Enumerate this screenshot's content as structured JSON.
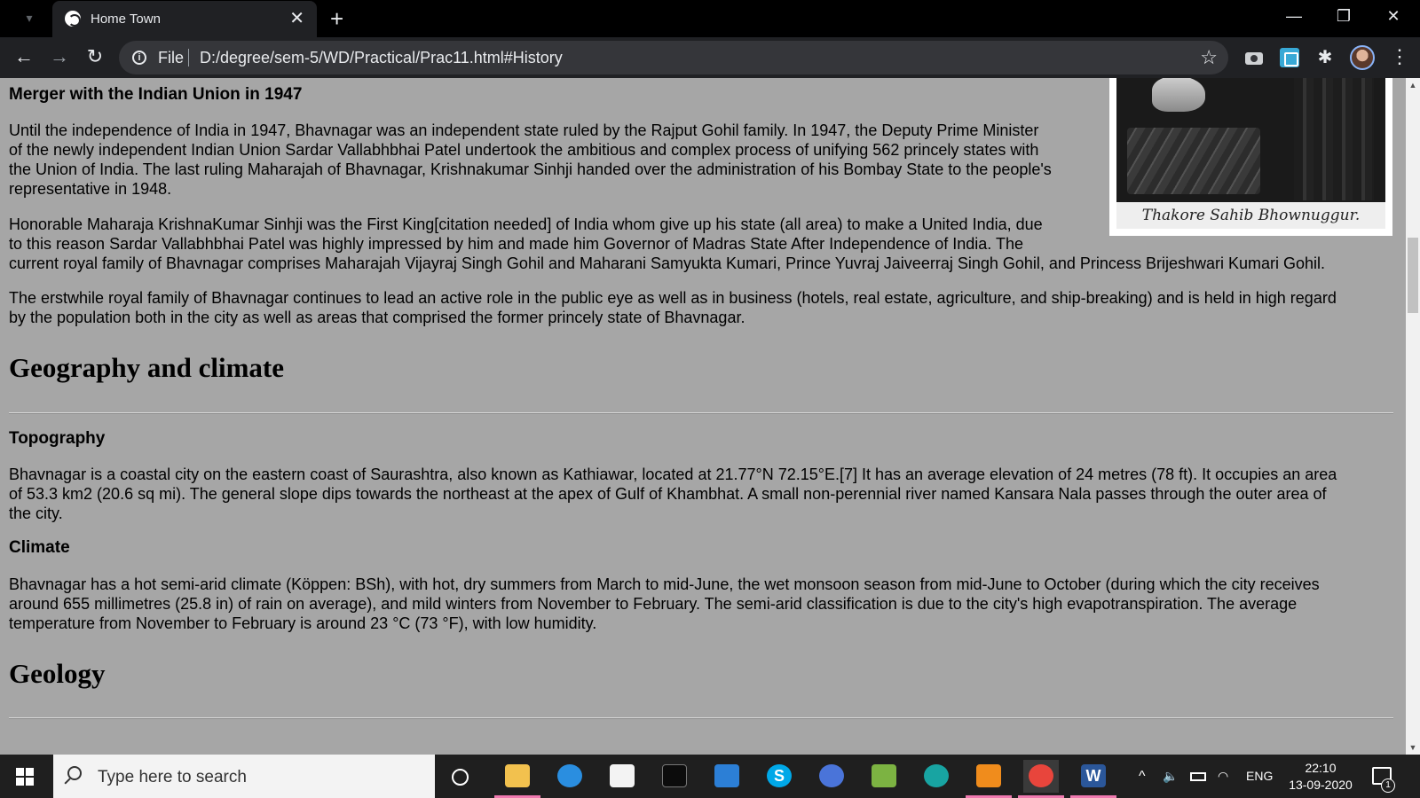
{
  "browser": {
    "tab_title": "Home Town",
    "tab_close_glyph": "✕",
    "new_tab_glyph": "+",
    "minimize_glyph": "—",
    "maximize_glyph": "❐",
    "close_glyph": "✕",
    "back_glyph": "←",
    "forward_glyph": "→",
    "reload_glyph": "↻",
    "info_glyph": "i",
    "scheme_label": "File",
    "url": "D:/degree/sem-5/WD/Practical/Prac11.html#History",
    "star_glyph": "☆",
    "puzzle_glyph": "✱",
    "menu_glyph": "⋮"
  },
  "page": {
    "image_caption": "Thakore Sahib Bhownuggur.",
    "merger": {
      "heading": "Merger with the Indian Union in 1947",
      "p1_l1": "Until the independence of India in 1947, Bhavnagar was an independent state ruled by the Rajput Gohil family. In 1947, the Deputy Prime Minister",
      "p1_l2": "of the newly independent Indian Union Sardar Vallabhbhai Patel undertook the ambitious and complex process of unifying 562 princely states with",
      "p1_l3": "the Union of India. The last ruling Maharajah of Bhavnagar, Krishnakumar Sinhji handed over the administration of his Bombay State to the people's",
      "p1_l4": "representative in 1948.",
      "p2_l1": "Honorable Maharaja KrishnaKumar Sinhji was the First King[citation needed] of India whom give up his state (all area) to make a United India, due",
      "p2_l2": "to this reason Sardar Vallabhbhai Patel was highly impressed by him and made him Governor of Madras State After Independence of India. The",
      "p2_l3": "current royal family of Bhavnagar comprises Maharajah Vijayraj Singh Gohil and Maharani Samyukta Kumari, Prince Yuvraj Jaiveerraj Singh Gohil, and Princess Brijeshwari Kumari Gohil.",
      "p3_l1": "The erstwhile royal family of Bhavnagar continues to lead an active role in the public eye as well as in business (hotels, real estate, agriculture, and ship-breaking) and is held in high regard",
      "p3_l2": "by the population both in the city as well as areas that comprised the former princely state of Bhavnagar."
    },
    "geography": {
      "heading": "Geography and climate",
      "topography_heading": "Topography",
      "topo_l1": "Bhavnagar is a coastal city on the eastern coast of Saurashtra, also known as Kathiawar, located at 21.77°N 72.15°E.[7] It has an average elevation of 24 metres (78 ft). It occupies an area",
      "topo_l2": "of 53.3 km2 (20.6 sq mi). The general slope dips towards the northeast at the apex of Gulf of Khambhat. A small non-perennial river named Kansara Nala passes through the outer area of",
      "topo_l3": "the city.",
      "climate_heading": "Climate",
      "clim_l1": "Bhavnagar has a hot semi-arid climate (Köppen: BSh), with hot, dry summers from March to mid-June, the wet monsoon season from mid-June to October (during which the city receives",
      "clim_l2": "around 655 millimetres (25.8 in) of rain on average), and mild winters from November to February. The semi-arid classification is due to the city's high evapotranspiration. The average",
      "clim_l3": "temperature from November to February is around 23 °C (73 °F), with low humidity."
    },
    "geology_heading": "Geology"
  },
  "taskbar": {
    "search_placeholder": "Type here to search",
    "apps": [
      {
        "name": "file-explorer",
        "color": "#f2c14e"
      },
      {
        "name": "internet-explorer",
        "color": "#2a8ee0"
      },
      {
        "name": "store",
        "color": "#f3f3f3"
      },
      {
        "name": "terminal",
        "color": "#0c0c0c"
      },
      {
        "name": "mail",
        "color": "#2c7fd6"
      },
      {
        "name": "skype",
        "color": "#00a8e8"
      },
      {
        "name": "chromium",
        "color": "#4a74d9"
      },
      {
        "name": "notepad-plus",
        "color": "#7cb342"
      },
      {
        "name": "edge",
        "color": "#18a4a2"
      },
      {
        "name": "sublime-text",
        "color": "#f08c1c"
      },
      {
        "name": "chrome",
        "color": "#e8453c"
      },
      {
        "name": "word",
        "color": "#2b579a"
      }
    ],
    "skype_letter": "S",
    "word_letter": "W",
    "tray_chevron": "^",
    "volume_glyph": "🔈",
    "language": "ENG",
    "time": "22:10",
    "date": "13-09-2020",
    "notification_count": "1"
  }
}
